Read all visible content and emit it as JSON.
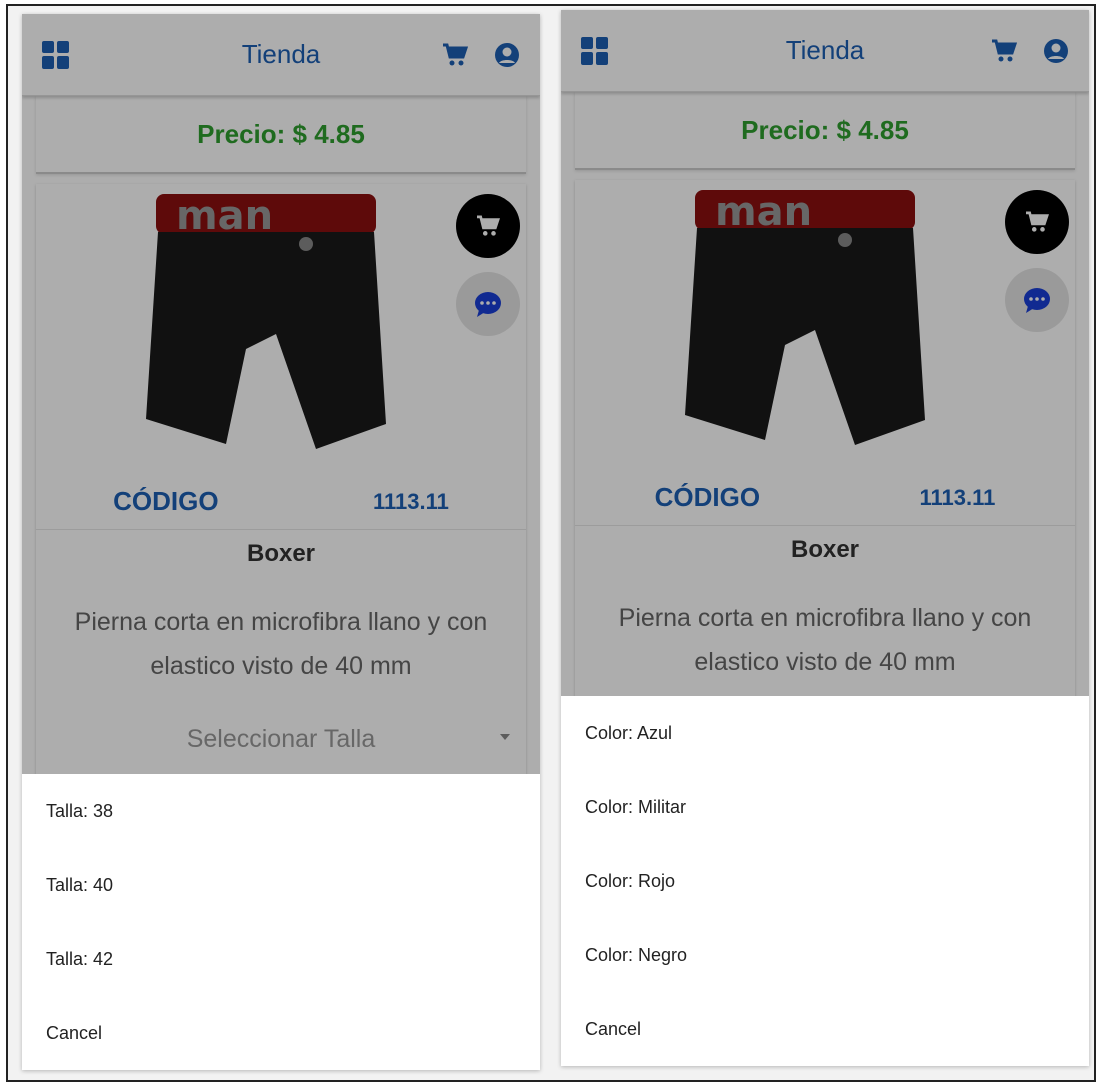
{
  "colors": {
    "brand_blue": "#1d5fb3",
    "price_green": "#2e9e2e",
    "overlay": "rgba(0,0,0,0.32)"
  },
  "screens": [
    {
      "header": {
        "title": "Tienda",
        "menu_icon": "grid-menu-icon",
        "cart_icon": "cart-icon",
        "account_icon": "account-icon"
      },
      "price": "Precio: $ 4.85",
      "product": {
        "code_label": "CÓDIGO",
        "code_value": "1113.11",
        "name": "Boxer",
        "description": "Pierna corta en microfibra llano y con elastico visto de 40 mm",
        "select_placeholder": "Seleccionar Talla"
      },
      "sheet": {
        "options": [
          "Talla: 38",
          "Talla: 40",
          "Talla: 42"
        ],
        "cancel": "Cancel"
      }
    },
    {
      "header": {
        "title": "Tienda",
        "menu_icon": "grid-menu-icon",
        "cart_icon": "cart-icon",
        "account_icon": "account-icon"
      },
      "price": "Precio: $ 4.85",
      "product": {
        "code_label": "CÓDIGO",
        "code_value": "1113.11",
        "name": "Boxer",
        "description": "Pierna corta en microfibra llano y con elastico visto de 40 mm"
      },
      "sheet": {
        "options": [
          "Color: Azul",
          "Color: Militar",
          "Color: Rojo",
          "Color: Negro"
        ],
        "cancel": "Cancel"
      }
    }
  ]
}
